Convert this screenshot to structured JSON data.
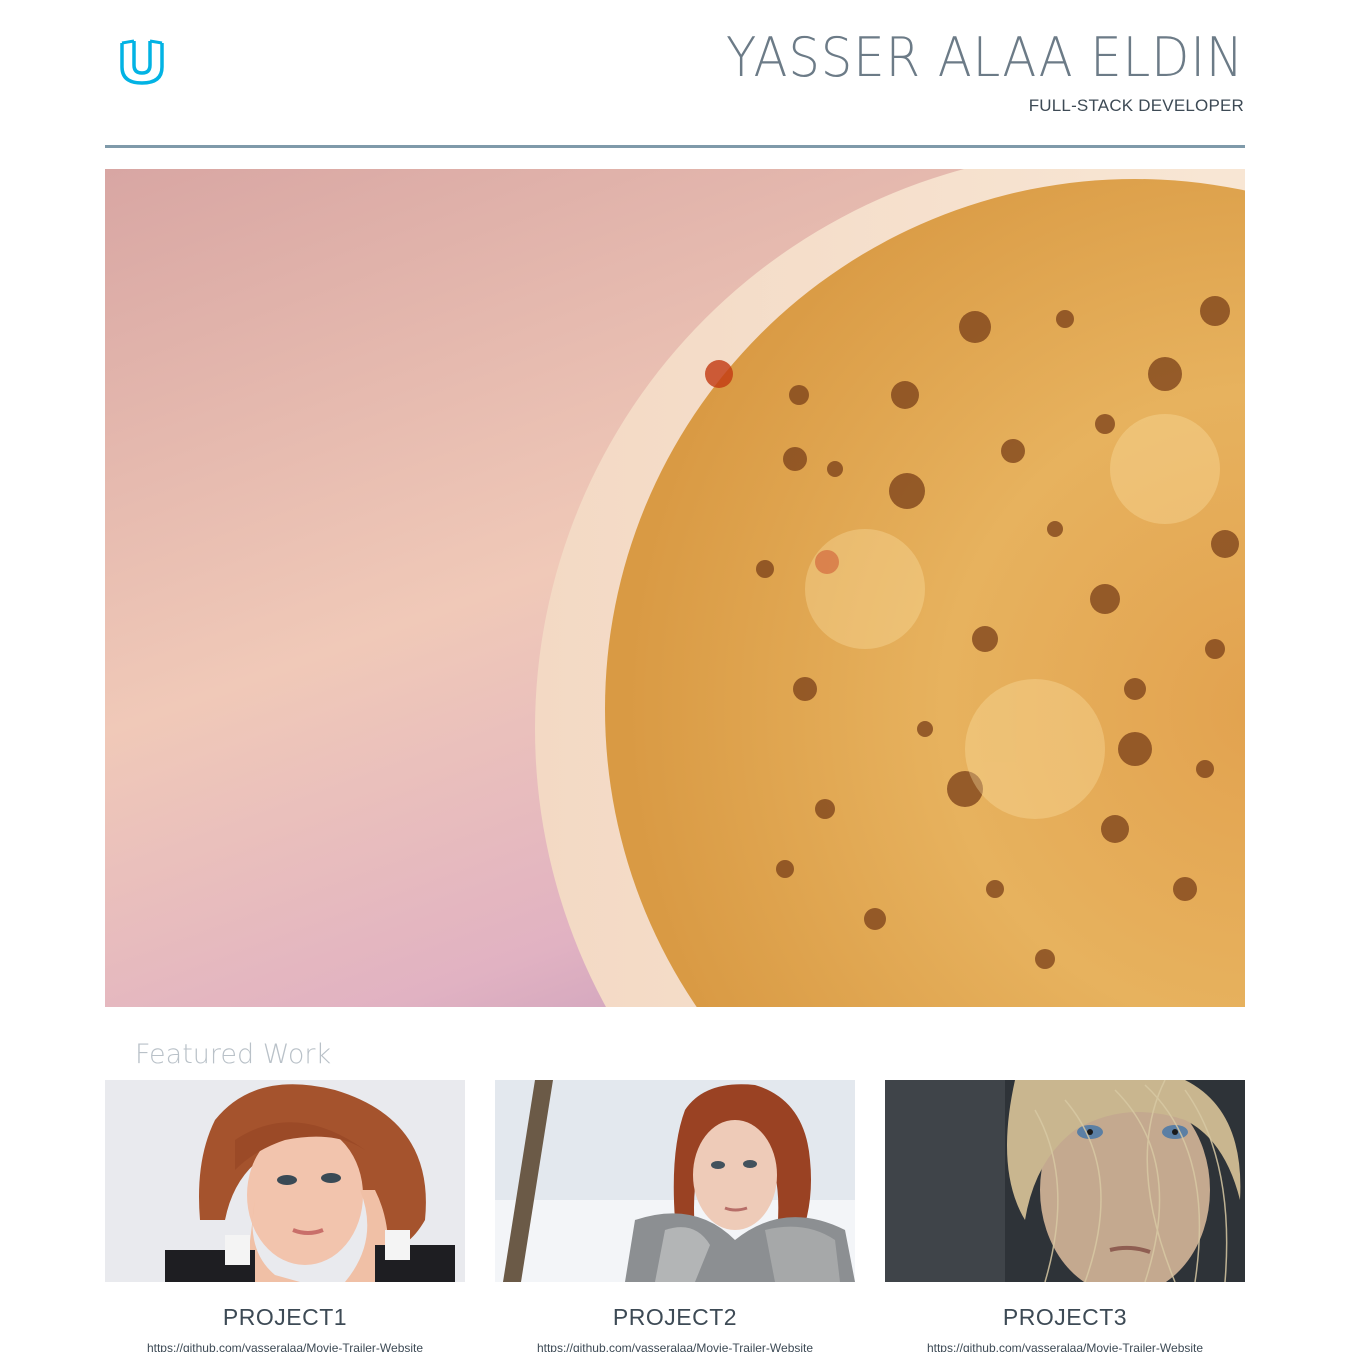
{
  "header": {
    "logo_icon": "udacity-logo-icon",
    "name": "YASSER ALAA ELDIN",
    "subtitle": "FULL-STACK DEVELOPER"
  },
  "hero": {
    "image": "coffee-cup-foam-photo"
  },
  "featured": {
    "title": "Featured Work",
    "projects": [
      {
        "title": "PROJECT1",
        "link": "https://github.com/yasseralaa/Movie-Trailer-Website",
        "image": "woman-red-hair-hands-on-face-photo"
      },
      {
        "title": "PROJECT2",
        "link": "https://github.com/yasseralaa/Movie-Trailer-Website",
        "image": "woman-red-hair-fur-snow-photo"
      },
      {
        "title": "PROJECT3",
        "link": "https://github.com/yasseralaa/Movie-Trailer-Website",
        "image": "girl-blonde-hair-blue-eyes-photo"
      }
    ]
  },
  "colors": {
    "accent": "#02b3e4",
    "divider": "#7f9aaa",
    "name_text": "#6c7b87",
    "featured_title": "#b9c1c8"
  }
}
